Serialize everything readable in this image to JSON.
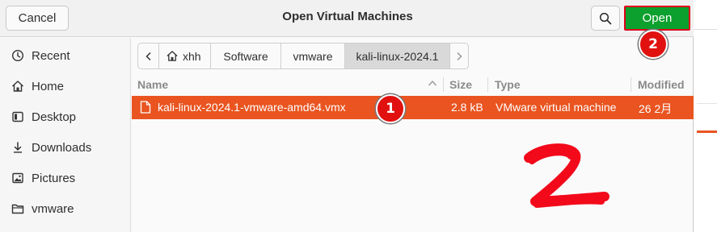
{
  "dialog": {
    "title": "Open Virtual Machines",
    "cancel_label": "Cancel",
    "open_label": "Open"
  },
  "sidebar": {
    "items": [
      {
        "label": "Recent",
        "icon": "clock-icon"
      },
      {
        "label": "Home",
        "icon": "home-icon"
      },
      {
        "label": "Desktop",
        "icon": "desktop-icon"
      },
      {
        "label": "Downloads",
        "icon": "download-icon"
      },
      {
        "label": "Pictures",
        "icon": "picture-icon"
      },
      {
        "label": "vmware",
        "icon": "folder-icon"
      }
    ]
  },
  "pathbar": {
    "segments": [
      "xhh",
      "Software",
      "vmware",
      "kali-linux-2024.1"
    ],
    "active": "kali-linux-2024.1"
  },
  "file_list": {
    "columns": [
      "Name",
      "Size",
      "Type",
      "Modified"
    ],
    "rows": [
      {
        "name": "kali-linux-2024.1-vmware-amd64.vmx",
        "size": "2.8 kB",
        "type": "VMware virtual machine",
        "modified": "26 2月",
        "selected": true
      }
    ]
  },
  "annotations": {
    "badge_1": "1",
    "badge_2": "2"
  },
  "colors": {
    "selection": "#e95420",
    "open_button": "#0ca02e",
    "annotation_red": "#e0110f"
  }
}
